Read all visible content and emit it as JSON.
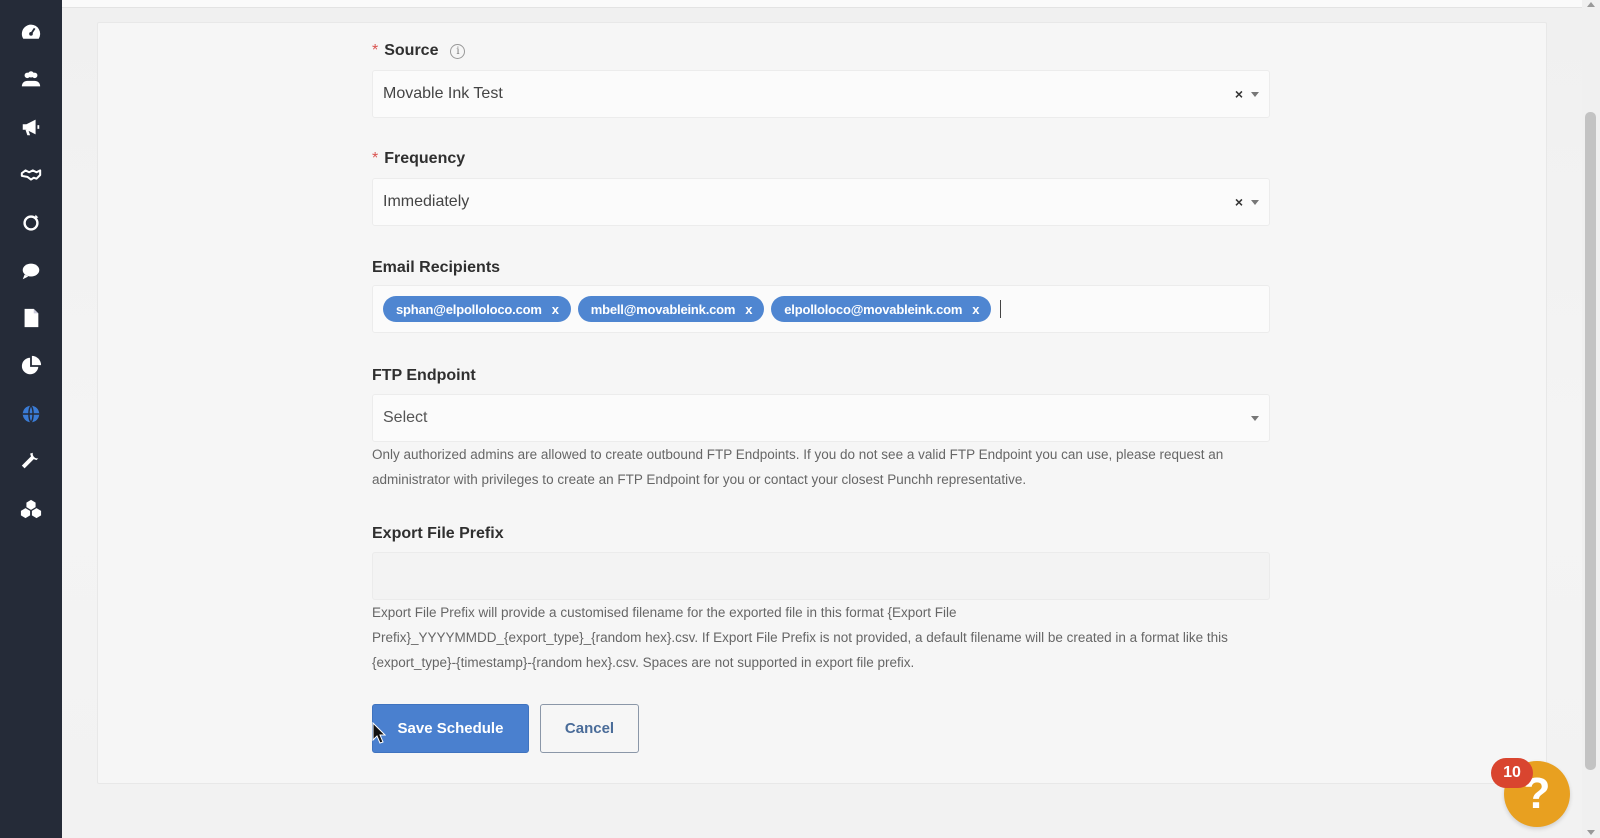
{
  "form": {
    "source": {
      "label": "Source",
      "info_icon": "info-icon",
      "value": "Movable Ink Test",
      "clear": "×"
    },
    "frequency": {
      "label": "Frequency",
      "value": "Immediately",
      "clear": "×"
    },
    "email_recipients": {
      "label": "Email Recipients",
      "tags": [
        {
          "email": "sphan@elpolloloco.com",
          "remove": "x"
        },
        {
          "email": "mbell@movableink.com",
          "remove": "x"
        },
        {
          "email": "elpolloloco@movableink.com",
          "remove": "x"
        }
      ]
    },
    "ftp_endpoint": {
      "label": "FTP Endpoint",
      "placeholder": "Select",
      "help_line1": "Only authorized admins are allowed to create outbound FTP Endpoints. If you do not see a valid FTP Endpoint you can use, please request an",
      "help_line2": "administrator with privileges to create an FTP Endpoint for you or contact your closest Punchh representative."
    },
    "export_file_prefix": {
      "label": "Export File Prefix",
      "value": "",
      "help_line1": "Export File Prefix will provide a customised filename for the exported file in this format {Export File",
      "help_line2": "Prefix}_YYYYMMDD_{export_type}_{random hex}.csv. If Export File Prefix is not provided, a default filename will be created in a format like this",
      "help_line3": "{export_type}-{timestamp}-{random hex}.csv. Spaces are not supported in export file prefix."
    },
    "required_marker": "*",
    "save_label": "Save Schedule",
    "cancel_label": "Cancel"
  },
  "sidebar": {
    "items": [
      {
        "icon": "dashboard-icon",
        "active": false
      },
      {
        "icon": "users-icon",
        "active": false
      },
      {
        "icon": "megaphone-icon",
        "active": false
      },
      {
        "icon": "handshake-icon",
        "active": false
      },
      {
        "icon": "loop-icon",
        "active": false
      },
      {
        "icon": "chat-icon",
        "active": false
      },
      {
        "icon": "document-icon",
        "active": false
      },
      {
        "icon": "pie-chart-icon",
        "active": false
      },
      {
        "icon": "globe-icon",
        "active": true
      },
      {
        "icon": "wrench-icon",
        "active": false
      },
      {
        "icon": "cubes-icon",
        "active": false
      }
    ]
  },
  "help_widget": {
    "symbol": "?",
    "badge_count": "10"
  },
  "colors": {
    "sidebar_bg": "#252b38",
    "sidebar_icon": "#ffffff",
    "sidebar_active": "#3a7bd5",
    "tag_bg": "#4f86d1",
    "primary_button": "#4a80cf",
    "help_button": "#e8a020",
    "badge": "#d9452f",
    "required": "#d9534f"
  }
}
